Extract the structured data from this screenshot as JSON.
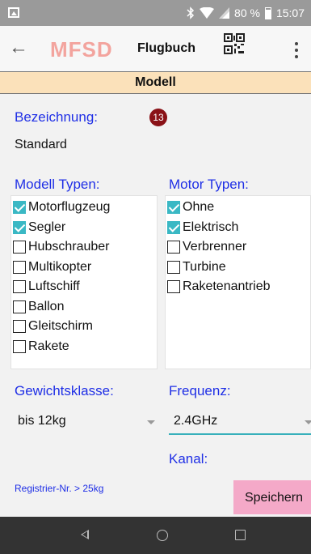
{
  "status_bar": {
    "battery_text": "80 %",
    "time": "15:07",
    "icons": [
      "gallery-icon",
      "bluetooth-icon",
      "wifi-icon",
      "signal-icon",
      "battery-icon"
    ]
  },
  "app_bar": {
    "logo": "MFSD",
    "title": "Flugbuch",
    "icons": [
      "back-arrow-icon",
      "qr-code-icon",
      "overflow-menu-icon"
    ]
  },
  "section": {
    "header": "Modell"
  },
  "bezeichnung": {
    "label": "Bezeichnung:",
    "badge": "13",
    "value": "Standard"
  },
  "modell_typen": {
    "label": "Modell Typen:",
    "items": [
      {
        "label": "Motorflugzeug",
        "checked": true
      },
      {
        "label": "Segler",
        "checked": true
      },
      {
        "label": "Hubschrauber",
        "checked": false
      },
      {
        "label": "Multikopter",
        "checked": false
      },
      {
        "label": "Luftschiff",
        "checked": false
      },
      {
        "label": "Ballon",
        "checked": false
      },
      {
        "label": "Gleitschirm",
        "checked": false
      },
      {
        "label": "Rakete",
        "checked": false
      }
    ]
  },
  "motor_typen": {
    "label": "Motor Typen:",
    "items": [
      {
        "label": "Ohne",
        "checked": true
      },
      {
        "label": "Elektrisch",
        "checked": true
      },
      {
        "label": "Verbrenner",
        "checked": false
      },
      {
        "label": "Turbine",
        "checked": false
      },
      {
        "label": "Raketenantrieb",
        "checked": false
      }
    ]
  },
  "gewichtsklasse": {
    "label": "Gewichtsklasse:",
    "selected": "bis 12kg"
  },
  "frequenz": {
    "label": "Frequenz:",
    "selected": "2.4GHz"
  },
  "registrier": {
    "text": "Registrier-Nr. > 25kg"
  },
  "kanal": {
    "label": "Kanal:"
  },
  "actions": {
    "save_label": "Speichern"
  },
  "colors": {
    "accent_teal": "#3ab8c4",
    "label_blue": "#1f2fe6",
    "header_bg": "#fbe1ba",
    "save_button_bg": "#f4a9c8",
    "badge_bg": "#8a1217"
  }
}
